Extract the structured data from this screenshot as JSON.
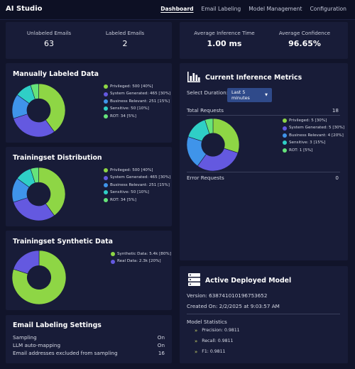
{
  "app": {
    "title": "AI Studio"
  },
  "nav": {
    "dashboard": "Dashboard",
    "email_labeling": "Email Labeling",
    "model_management": "Model Management",
    "configuration": "Configuration"
  },
  "stats": {
    "unlabeled_label": "Unlabeled Emails",
    "unlabeled_value": "63",
    "labeled_label": "Labeled Emails",
    "labeled_value": "2",
    "inference_label": "Average Inference Time",
    "inference_value": "1.00 ms",
    "confidence_label": "Average Confidence",
    "confidence_value": "96.65%"
  },
  "colors": {
    "privileged": "#8ed645",
    "system": "#6459e0",
    "business": "#3f94ea",
    "sensitive": "#2fcfc6",
    "rot": "#66e47a"
  },
  "manual": {
    "title": "Manually Labeled Data",
    "legend": [
      {
        "label": "Privileged: 500 [40%]"
      },
      {
        "label": "System Generated: 465 [30%]"
      },
      {
        "label": "Business Relevant: 251 [15%]"
      },
      {
        "label": "Sensitive: 50 [10%]"
      },
      {
        "label": "ROT: 34 [5%]"
      }
    ]
  },
  "training": {
    "title": "Trainingset Distribution",
    "legend": [
      {
        "label": "Privileged: 500 [40%]"
      },
      {
        "label": "System Generated: 465 [30%]"
      },
      {
        "label": "Business Relevant: 251 [15%]"
      },
      {
        "label": "Sensitive: 50 [10%]"
      },
      {
        "label": "ROT: 34 [5%]"
      }
    ]
  },
  "synthetic": {
    "title": "Trainingset Synthetic Data",
    "legend": [
      {
        "label": "Synthetic Data: 5.4k [80%]"
      },
      {
        "label": "Real Data: 2.3k [20%]"
      }
    ],
    "colors": [
      "#8ed645",
      "#6459e0"
    ]
  },
  "settings": {
    "title": "Email Labeling Settings",
    "rows": [
      {
        "label": "Sampling",
        "value": "On"
      },
      {
        "label": "LLM auto-mapping",
        "value": "On"
      },
      {
        "label": "Email addresses excluded from sampling",
        "value": "16"
      }
    ]
  },
  "metrics": {
    "title": "Current Inference Metrics",
    "duration_label": "Select Duration:",
    "duration_value": "Last 5 minutes",
    "total_label": "Total Requests",
    "total_value": "18",
    "error_label": "Error Requests",
    "error_value": "0",
    "legend": [
      {
        "label": "Privileged: 5 [30%]"
      },
      {
        "label": "System Generated: 5 [30%]"
      },
      {
        "label": "Business Relevant: 4 [20%]"
      },
      {
        "label": "Sensitive: 3 [15%]"
      },
      {
        "label": "ROT: 1 [5%]"
      }
    ]
  },
  "model": {
    "title": "Active Deployed Model",
    "version": "Version: 638741010196753652",
    "created": "Created On: 2/2/2025 at 9:03:57 AM",
    "stats_title": "Model Statistics",
    "precision": "Precision: 0.9811",
    "recall": "Recall: 0.9811",
    "f1": "F1: 0.9811"
  },
  "chart_data": [
    {
      "type": "pie",
      "title": "Manually Labeled Data",
      "categories": [
        "Privileged",
        "System Generated",
        "Business Relevant",
        "Sensitive",
        "ROT"
      ],
      "values": [
        40,
        30,
        15,
        10,
        5
      ]
    },
    {
      "type": "pie",
      "title": "Trainingset Distribution",
      "categories": [
        "Privileged",
        "System Generated",
        "Business Relevant",
        "Sensitive",
        "ROT"
      ],
      "values": [
        40,
        30,
        15,
        10,
        5
      ]
    },
    {
      "type": "pie",
      "title": "Trainingset Synthetic Data",
      "categories": [
        "Synthetic Data",
        "Real Data"
      ],
      "values": [
        80,
        20
      ]
    },
    {
      "type": "pie",
      "title": "Current Inference Metrics",
      "categories": [
        "Privileged",
        "System Generated",
        "Business Relevant",
        "Sensitive",
        "ROT"
      ],
      "values": [
        30,
        30,
        20,
        15,
        5
      ]
    }
  ]
}
